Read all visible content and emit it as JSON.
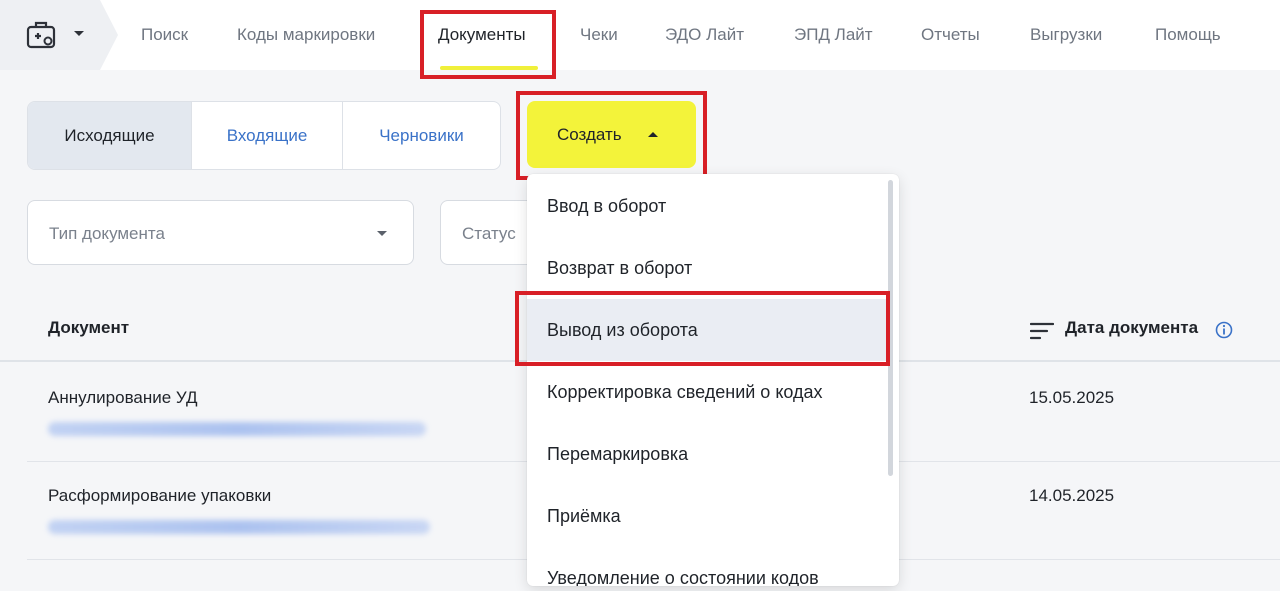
{
  "app": {
    "icon": "medical-case-icon",
    "switch_caret": "chevron-down-icon"
  },
  "nav": {
    "items": [
      {
        "label": "Поиск",
        "active": false
      },
      {
        "label": "Коды маркировки",
        "active": false
      },
      {
        "label": "Документы",
        "active": true
      },
      {
        "label": "Чеки",
        "active": false
      },
      {
        "label": "ЭДО Лайт",
        "active": false
      },
      {
        "label": "ЭПД Лайт",
        "active": false
      },
      {
        "label": "Отчеты",
        "active": false
      },
      {
        "label": "Выгрузки",
        "active": false
      },
      {
        "label": "Помощь",
        "active": false
      }
    ]
  },
  "tabs": {
    "items": [
      {
        "label": "Исходящие",
        "active": true
      },
      {
        "label": "Входящие",
        "active": false
      },
      {
        "label": "Черновики",
        "active": false
      }
    ]
  },
  "create_button": {
    "label": "Создать",
    "icon": "caret-up-icon"
  },
  "filters": {
    "doc_type_placeholder": "Тип документа",
    "status_placeholder": "Статус"
  },
  "table": {
    "columns": {
      "document": "Документ",
      "date": "Дата документа"
    },
    "rows": [
      {
        "name": "Аннулирование УД",
        "date": "15.05.2025"
      },
      {
        "name": "Расформирование упаковки",
        "date": "14.05.2025"
      }
    ]
  },
  "create_menu": {
    "items": [
      "Ввод в оборот",
      "Возврат в оборот",
      "Вывод из оборота",
      "Корректировка сведений о кодах",
      "Перемаркировка",
      "Приёмка",
      "Уведомление о состоянии кодов"
    ],
    "highlighted": "Вывод из оборота"
  },
  "colors": {
    "accent_yellow": "#f3f33a",
    "highlight_red": "#d81f26",
    "link_blue": "#3a72c8"
  }
}
